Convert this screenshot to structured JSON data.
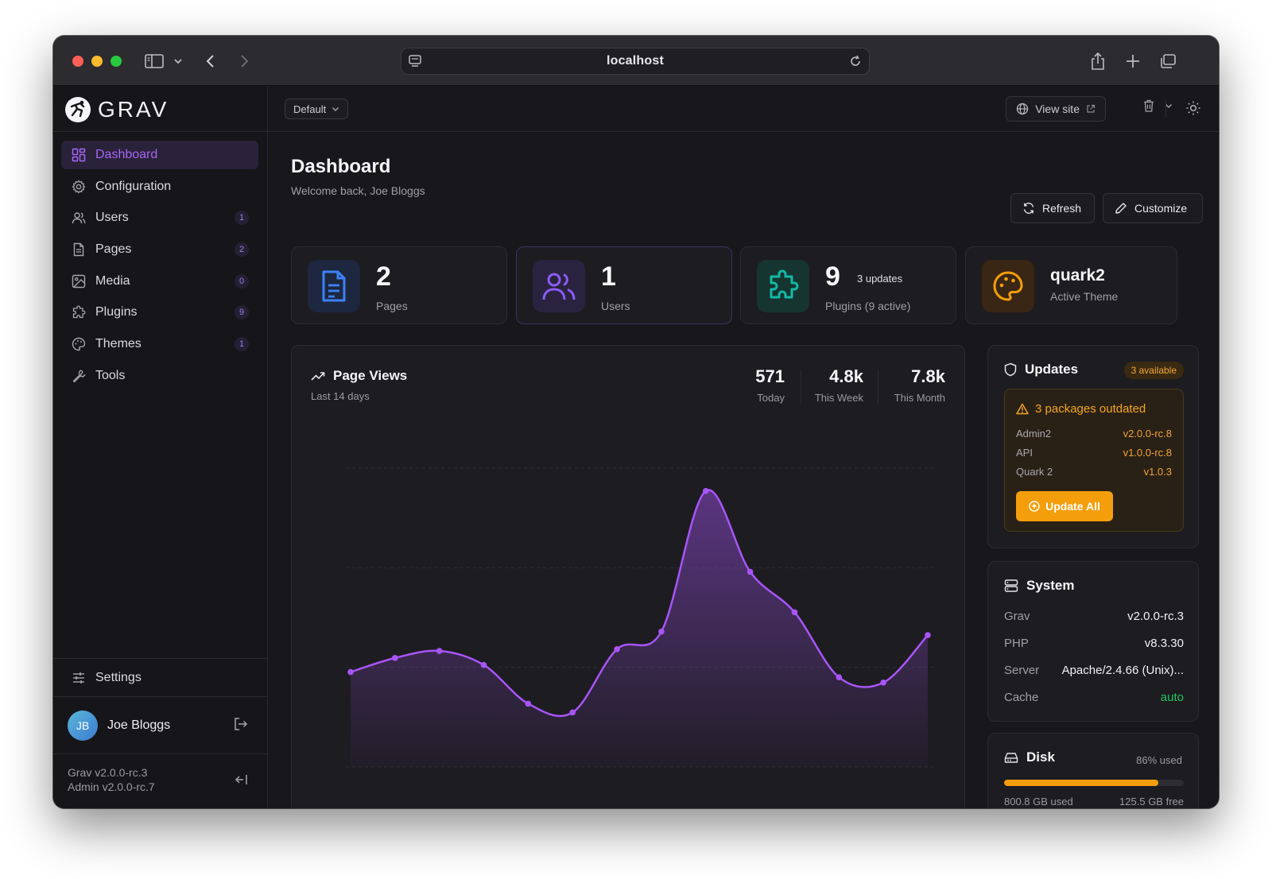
{
  "browser": {
    "url": "localhost"
  },
  "brand": {
    "name": "GRAV"
  },
  "sidebar": {
    "items": [
      {
        "label": "Dashboard",
        "badge": "",
        "active": true
      },
      {
        "label": "Configuration",
        "badge": ""
      },
      {
        "label": "Users",
        "badge": "1"
      },
      {
        "label": "Pages",
        "badge": "2"
      },
      {
        "label": "Media",
        "badge": "0"
      },
      {
        "label": "Plugins",
        "badge": "9"
      },
      {
        "label": "Themes",
        "badge": "1"
      },
      {
        "label": "Tools",
        "badge": ""
      }
    ],
    "settings_label": "Settings",
    "user": {
      "initials": "JB",
      "name": "Joe Bloggs"
    },
    "versions": {
      "grav": "Grav v2.0.0-rc.3",
      "admin": "Admin v2.0.0-rc.7"
    }
  },
  "topbar": {
    "environment": "Default",
    "view_site": "View site"
  },
  "header": {
    "title": "Dashboard",
    "subtitle": "Welcome back, Joe Bloggs",
    "refresh": "Refresh",
    "customize": "Customize"
  },
  "stats": {
    "pages": {
      "value": "2",
      "label": "Pages"
    },
    "users": {
      "value": "1",
      "label": "Users"
    },
    "plugins": {
      "value": "9",
      "label": "Plugins (9 active)",
      "extra": "3 updates"
    },
    "theme": {
      "value": "quark2",
      "label": "Active Theme"
    }
  },
  "pageviews": {
    "title": "Page Views",
    "subtitle": "Last 14 days",
    "today": {
      "value": "571",
      "label": "Today"
    },
    "week": {
      "value": "4.8k",
      "label": "This Week"
    },
    "month": {
      "value": "7.8k",
      "label": "This Month"
    }
  },
  "chart_data": {
    "type": "area",
    "x": [
      1,
      2,
      3,
      4,
      5,
      6,
      7,
      8,
      9,
      10,
      11,
      12,
      13,
      14
    ],
    "series": [
      {
        "values": [
          270,
          310,
          330,
          290,
          180,
          155,
          335,
          385,
          785,
          555,
          440,
          255,
          240,
          375
        ]
      }
    ],
    "ylim": [
      0,
      850
    ],
    "grid": true,
    "color": "#a855f7"
  },
  "updates": {
    "title": "Updates",
    "badge": "3 available",
    "warning": "3 packages outdated",
    "packages": [
      {
        "name": "Admin2",
        "version": "v2.0.0-rc.8"
      },
      {
        "name": "API",
        "version": "v1.0.0-rc.8"
      },
      {
        "name": "Quark 2",
        "version": "v1.0.3"
      }
    ],
    "button": "Update All"
  },
  "system": {
    "title": "System",
    "rows": [
      {
        "key": "Grav",
        "value": "v2.0.0-rc.3"
      },
      {
        "key": "PHP",
        "value": "v8.3.30"
      },
      {
        "key": "Server",
        "value": "Apache/2.4.66 (Unix)..."
      },
      {
        "key": "Cache",
        "value": "auto"
      }
    ]
  },
  "disk": {
    "title": "Disk",
    "used_pct_label": "86% used",
    "used_fraction": 0.86,
    "used": "800.8 GB used",
    "free": "125.5 GB free"
  },
  "colors": {
    "accent": "#a855f7",
    "warning": "#f59e0b",
    "success": "#22c55e",
    "background": "#18171b"
  }
}
